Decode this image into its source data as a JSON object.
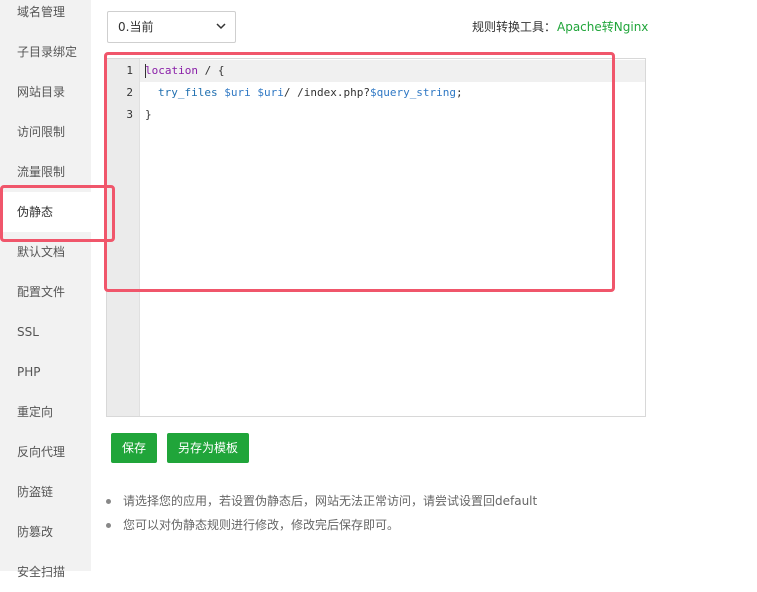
{
  "sidebar": {
    "items": [
      {
        "label": "域名管理"
      },
      {
        "label": "子目录绑定"
      },
      {
        "label": "网站目录"
      },
      {
        "label": "访问限制"
      },
      {
        "label": "流量限制"
      },
      {
        "label": "伪静态",
        "active": true
      },
      {
        "label": "默认文档"
      },
      {
        "label": "配置文件"
      },
      {
        "label": "SSL"
      },
      {
        "label": "PHP"
      },
      {
        "label": "重定向"
      },
      {
        "label": "反向代理"
      },
      {
        "label": "防盗链"
      },
      {
        "label": "防篡改"
      },
      {
        "label": "安全扫描"
      }
    ]
  },
  "toolbar": {
    "version_select_value": "0.当前",
    "tool_label": "规则转换工具：",
    "tool_link": "Apache转Nginx"
  },
  "editor": {
    "line_numbers": [
      "1",
      "2",
      "3"
    ],
    "lines": {
      "l1_kw": "location",
      "l1_rest": " / {",
      "l2_fn": "try_files",
      "l2_v1": "$uri",
      "l2_v2": "$uri",
      "l2_mid": "/ /index.php?",
      "l2_v3": "$query_string",
      "l2_end": ";",
      "l3": "}"
    }
  },
  "buttons": {
    "save": "保存",
    "save_as_template": "另存为模板"
  },
  "tips": [
    "请选择您的应用，若设置伪静态后，网站无法正常访问，请尝试设置回default",
    "您可以对伪静态规则进行修改，修改完后保存即可。"
  ],
  "colors": {
    "accent": "#20a53a",
    "highlight": "#f0566b",
    "sidebar_bg": "#f2f2f2"
  }
}
